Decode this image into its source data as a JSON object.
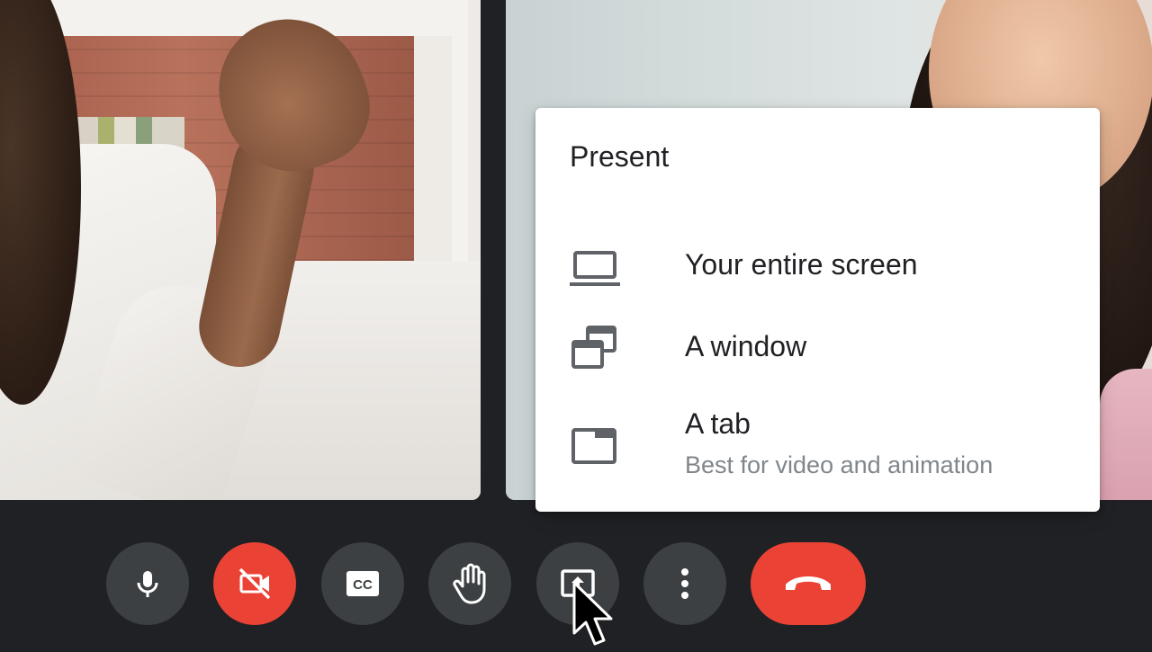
{
  "present_menu": {
    "title": "Present",
    "items": [
      {
        "label": "Your entire screen",
        "icon": "laptop-icon"
      },
      {
        "label": "A window",
        "icon": "window-icon"
      },
      {
        "label": "A tab",
        "subtitle": "Best for video and animation",
        "icon": "tab-icon"
      }
    ]
  },
  "controls": [
    {
      "name": "microphone",
      "icon": "microphone-icon"
    },
    {
      "name": "camera-off",
      "icon": "camera-off-icon",
      "color": "#ea4335"
    },
    {
      "name": "captions",
      "icon": "closed-captions-icon"
    },
    {
      "name": "raise-hand",
      "icon": "hand-icon"
    },
    {
      "name": "present-now",
      "icon": "present-screen-icon"
    },
    {
      "name": "more-options",
      "icon": "more-vert-icon"
    },
    {
      "name": "leave-call",
      "icon": "end-call-icon",
      "color": "#ea4335"
    }
  ],
  "colors": {
    "control_bg": "#3c4043",
    "danger": "#ea4335",
    "background": "#202124"
  }
}
